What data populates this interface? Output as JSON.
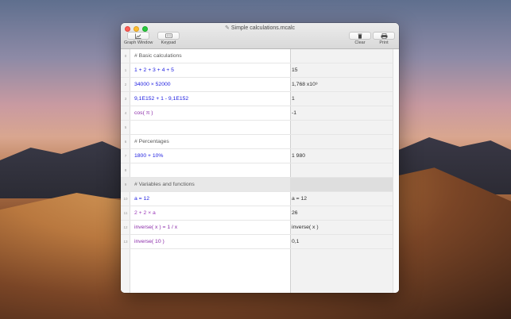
{
  "window": {
    "title": "Simple calculations.mcalc"
  },
  "toolbar": {
    "graph_window_label": "Graph Window",
    "keypad_label": "Keypad",
    "clear_label": "Clear",
    "print_label": "Print"
  },
  "lines": [
    {
      "num": "0",
      "expr_html": "comment",
      "text": "# Basic calculations",
      "result": ""
    },
    {
      "num": "1",
      "text": "1 + 2 + 3 + 4 + 5",
      "result": "15"
    },
    {
      "num": "2",
      "text": "34000 × 52000",
      "result": "1,768 x10⁹"
    },
    {
      "num": "3",
      "text": "9,1E152 + 1  - 9,1E152",
      "result": "1"
    },
    {
      "num": "4",
      "text": "cos( π )",
      "result": "-1"
    },
    {
      "num": "5",
      "text": "",
      "result": ""
    },
    {
      "num": "6",
      "text": "# Percentages",
      "result": ""
    },
    {
      "num": "7",
      "text": "1800 + 10%",
      "result": "1 980"
    },
    {
      "num": "8",
      "text": "",
      "result": ""
    },
    {
      "num": "9",
      "text": "# Variables and functions",
      "result": ""
    },
    {
      "num": "10",
      "text": "a = 12",
      "result": "a = 12"
    },
    {
      "num": "11",
      "text": "2 + 2 × a",
      "result": "26"
    },
    {
      "num": "12",
      "text": "inverse( x ) = 1 / x",
      "result": "inverse( x )"
    },
    {
      "num": "13",
      "text": "inverse( 10 )",
      "result": "0,1"
    }
  ],
  "colors": {
    "number": "#1a1ae0",
    "operator": "#9b3ab9",
    "function": "#8a2aa8",
    "comment": "#5a5a5a"
  },
  "icons": {
    "graph": "graph-icon",
    "keypad": "keypad-icon",
    "clear": "trash-icon",
    "print": "printer-icon"
  }
}
